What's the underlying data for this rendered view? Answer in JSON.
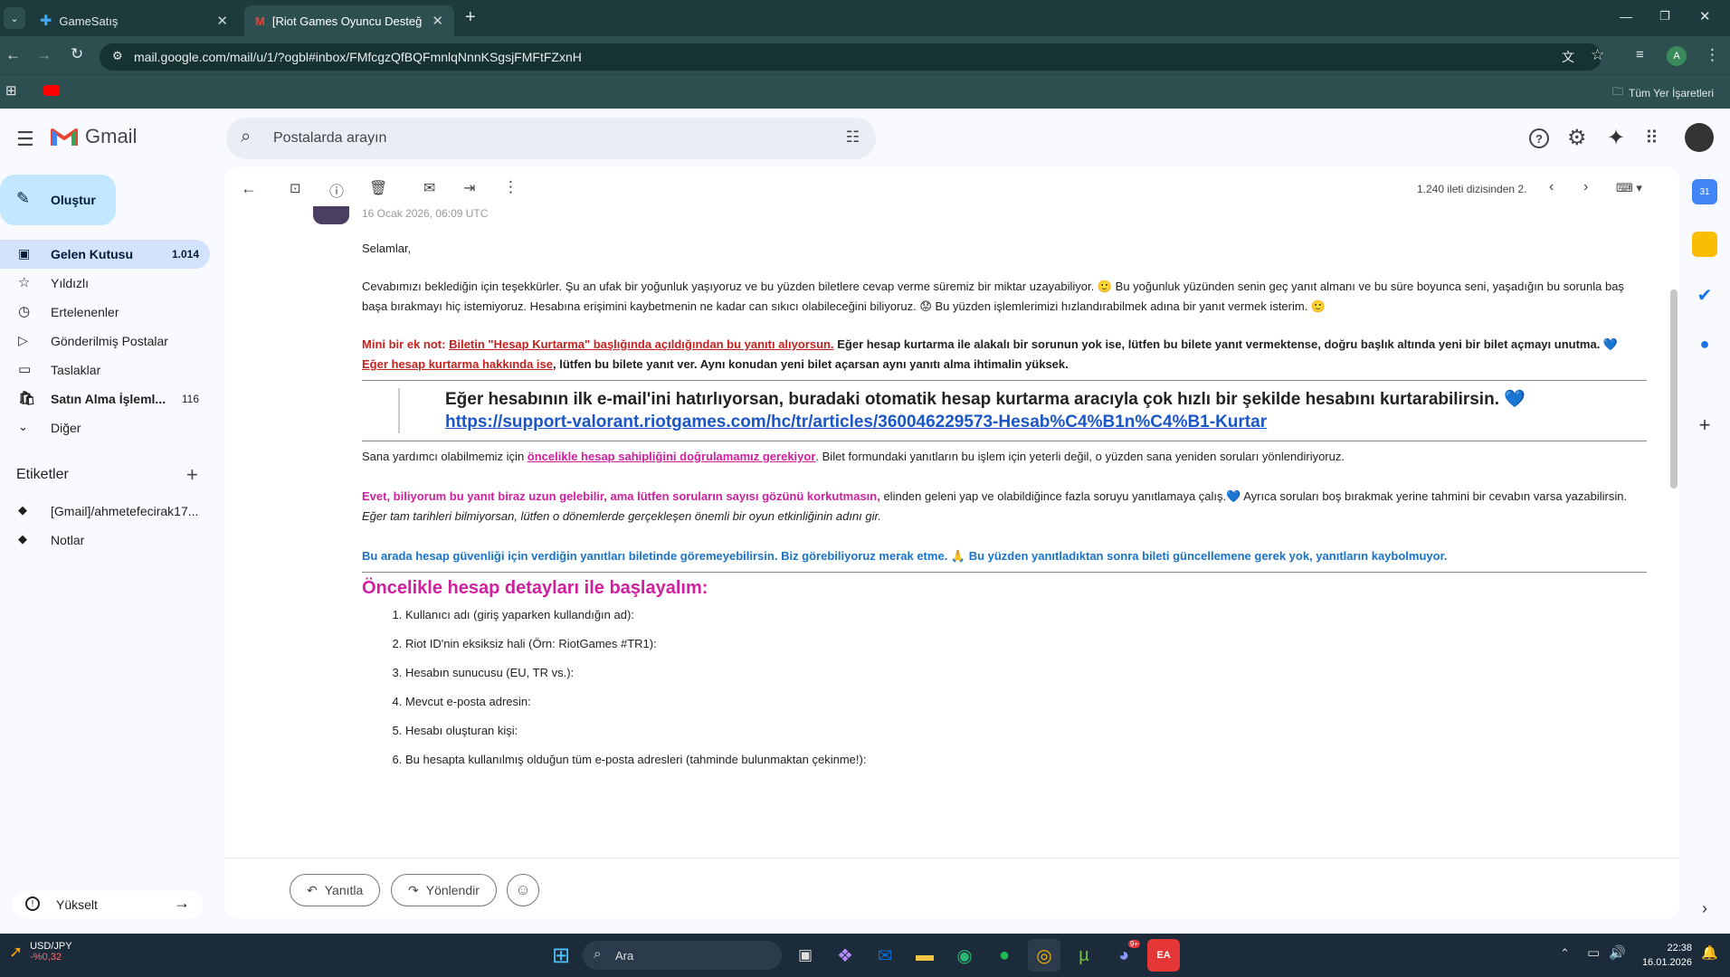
{
  "browser": {
    "tabs": [
      {
        "title": "GameSatış",
        "active": false
      },
      {
        "title": "[Riot Games Oyuncu Desteği] Y",
        "active": true
      }
    ],
    "url": "mail.google.com/mail/u/1/?ogbl#inbox/FMfcgzQfBQFmnlqNnnKSgsjFMFtFZxnH",
    "bookmarks_label": "Tüm Yer İşaretleri",
    "profile_initial": "A"
  },
  "gmail": {
    "logo_text": "Gmail",
    "search_placeholder": "Postalarda arayın",
    "compose_label": "Oluştur",
    "nav": [
      {
        "label": "Gelen Kutusu",
        "count": "1.014",
        "icon": "inbox-icon",
        "active": true
      },
      {
        "label": "Yıldızlı",
        "count": "",
        "icon": "star-icon",
        "active": false
      },
      {
        "label": "Ertelenenler",
        "count": "",
        "icon": "clock-icon",
        "active": false
      },
      {
        "label": "Gönderilmiş Postalar",
        "count": "",
        "icon": "send-icon",
        "active": false
      },
      {
        "label": "Taslaklar",
        "count": "",
        "icon": "draft-icon",
        "active": false
      },
      {
        "label": "Satın Alma İşleml...",
        "count": "116",
        "icon": "purchase-icon",
        "active": false
      },
      {
        "label": "Diğer",
        "count": "",
        "icon": "chevron-down-icon",
        "active": false
      }
    ],
    "labels_heading": "Etiketler",
    "labels": [
      {
        "label": "[Gmail]/ahmetefecirak17..."
      },
      {
        "label": "Notlar"
      }
    ],
    "upgrade_label": "Yükselt",
    "toolbar": {
      "pagination": "1.240 ileti dizisinden 2."
    }
  },
  "message": {
    "date": "16 Ocak 2026, 06:09 UTC",
    "greeting": "Selamlar,",
    "para1": "Cevabımızı beklediğin için teşekkürler. Şu an ufak bir yoğunluk yaşıyoruz ve bu yüzden biletlere cevap verme süremiz bir miktar uzayabiliyor. 🙂 Bu yoğunluk yüzünden senin geç yanıt almanı ve bu süre boyunca seni, yaşadığın bu sorunla baş başa bırakmayı hiç istemiyoruz. Hesabına erişimini kaybetmenin ne kadar can sıkıcı olabileceğini biliyoruz. 😟 Bu yüzden işlemlerimizi hızlandırabilmek adına bir yanıt vermek isterim. 🙂",
    "note_label": "Mini bir ek not:",
    "note_link": "Biletin \"Hesap Kurtarma\" başlığında açıldığından bu yanıtı alıyorsun.",
    "note_rest": " Eğer hesap kurtarma ile alakalı bir sorunun yok ise, lütfen bu bilete yanıt vermektense, doğru başlık altında yeni bir bilet açmayı unutma. 💙",
    "note2_link": "Eğer hesap kurtarma hakkında ise",
    "note2_rest": ", lütfen bu bilete yanıt ver. Aynı konudan yeni bilet açarsan aynı yanıtı alma ihtimalin yüksek.",
    "quote_text": "Eğer hesabının ilk e-mail'ini hatırlıyorsan, buradaki otomatik hesap kurtarma aracıyla çok hızlı bir şekilde hesabını kurtarabilirsin. 💙",
    "quote_link": "https://support-valorant.riotgames.com/hc/tr/articles/360046229573-Hesab%C4%B1n%C4%B1-Kurtar",
    "para3_a": "Sana yardımcı olabilmemiz için ",
    "para3_link": "öncelikle hesap sahipliğini doğrulamamız gerekiyor",
    "para3_b": ". Bilet formundaki yanıtların bu işlem için yeterli değil, o yüzden sana yeniden soruları yönlendiriyoruz.",
    "para4_bold": "Evet, biliyorum bu yanıt biraz uzun gelebilir, ama lütfen soruların sayısı gözünü korkutmasın,",
    "para4_rest": " elinden geleni yap ve olabildiğince fazla soruyu yanıtlamaya çalış.💙 Ayrıca soruları boş bırakmak yerine tahmini bir cevabın varsa yazabilirsin.",
    "para4_italic": "Eğer tam tarihleri bilmiyorsan, lütfen o dönemlerde gerçekleşen önemli bir oyun etkinliğinin adını gir.",
    "para5": "Bu arada hesap güvenliği için verdiğin yanıtları biletinde göremeyebilirsin. Biz görebiliyoruz merak etme. 🙏 Bu yüzden yanıtladıktan sonra bileti güncellemene gerek yok, yanıtların kaybolmuyor.",
    "section_title": "Öncelikle hesap detayları ile başlayalım:",
    "questions": [
      "Kullanıcı adı (giriş yaparken kullandığın ad):",
      "Riot ID'nin eksiksiz hali (Örn: RiotGames #TR1):",
      "Hesabın sunucusu (EU, TR vs.):",
      "Mevcut e-posta adresin:",
      "Hesabı oluşturan kişi:",
      "Bu hesapta kullanılmış olduğun tüm e-posta adresleri (tahminde bulunmaktan çekinme!):"
    ],
    "reply_label": "Yanıtla",
    "forward_label": "Yönlendir"
  },
  "taskbar": {
    "ticker_name": "USD/JPY",
    "ticker_value": "-%0,32",
    "search_label": "Ara",
    "time": "22:38",
    "date": "16.01.2026",
    "discord_badge": "9+"
  },
  "colors": {
    "accent": "#c2e7ff",
    "active_nav": "#d3e3fd",
    "chrome_bg": "#1d3b3c",
    "link_red": "#c5221f",
    "pink": "#d01f9f",
    "blue": "#1a73c8"
  }
}
